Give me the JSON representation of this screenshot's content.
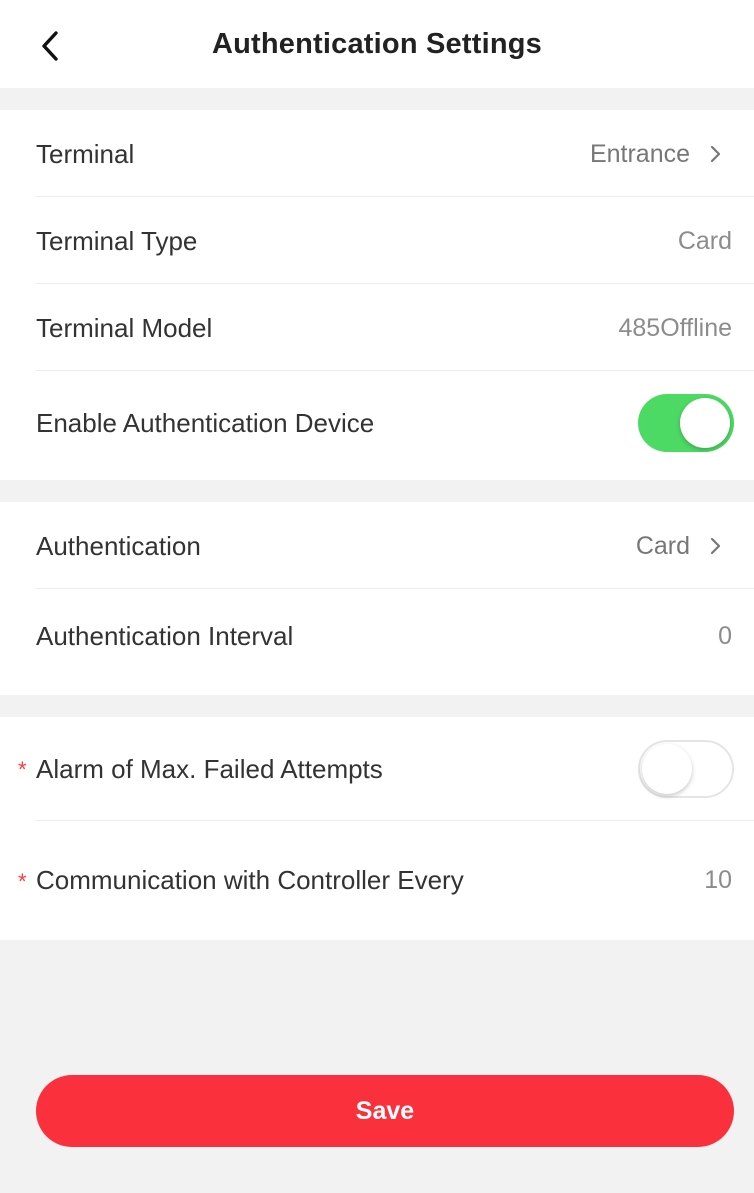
{
  "header": {
    "title": "Authentication Settings",
    "back_icon": "chevron-left-icon"
  },
  "groups": [
    {
      "rows": [
        {
          "label": "Terminal",
          "value": "Entrance",
          "type": "link"
        },
        {
          "label": "Terminal Type",
          "value": "Card",
          "type": "text"
        },
        {
          "label": "Terminal Model",
          "value": "485Offline",
          "type": "text"
        },
        {
          "label": "Enable Authentication Device",
          "type": "toggle",
          "enabled": true
        }
      ]
    },
    {
      "rows": [
        {
          "label": "Authentication",
          "value": "Card",
          "type": "link"
        },
        {
          "label": "Authentication Interval",
          "value": "0",
          "type": "text"
        }
      ]
    },
    {
      "rows": [
        {
          "label": "Alarm of Max. Failed Attempts",
          "type": "toggle",
          "enabled": false,
          "required": true,
          "required_mark": "*"
        },
        {
          "label": "Communication with Controller Every",
          "value": "10",
          "type": "text",
          "required": true,
          "required_mark": "*"
        }
      ]
    }
  ],
  "save_button": {
    "label": "Save"
  },
  "colors": {
    "accent": "#fa313c",
    "toggle_on": "#4cd964",
    "required": "#ff3b3b",
    "background": "#f2f2f2"
  }
}
